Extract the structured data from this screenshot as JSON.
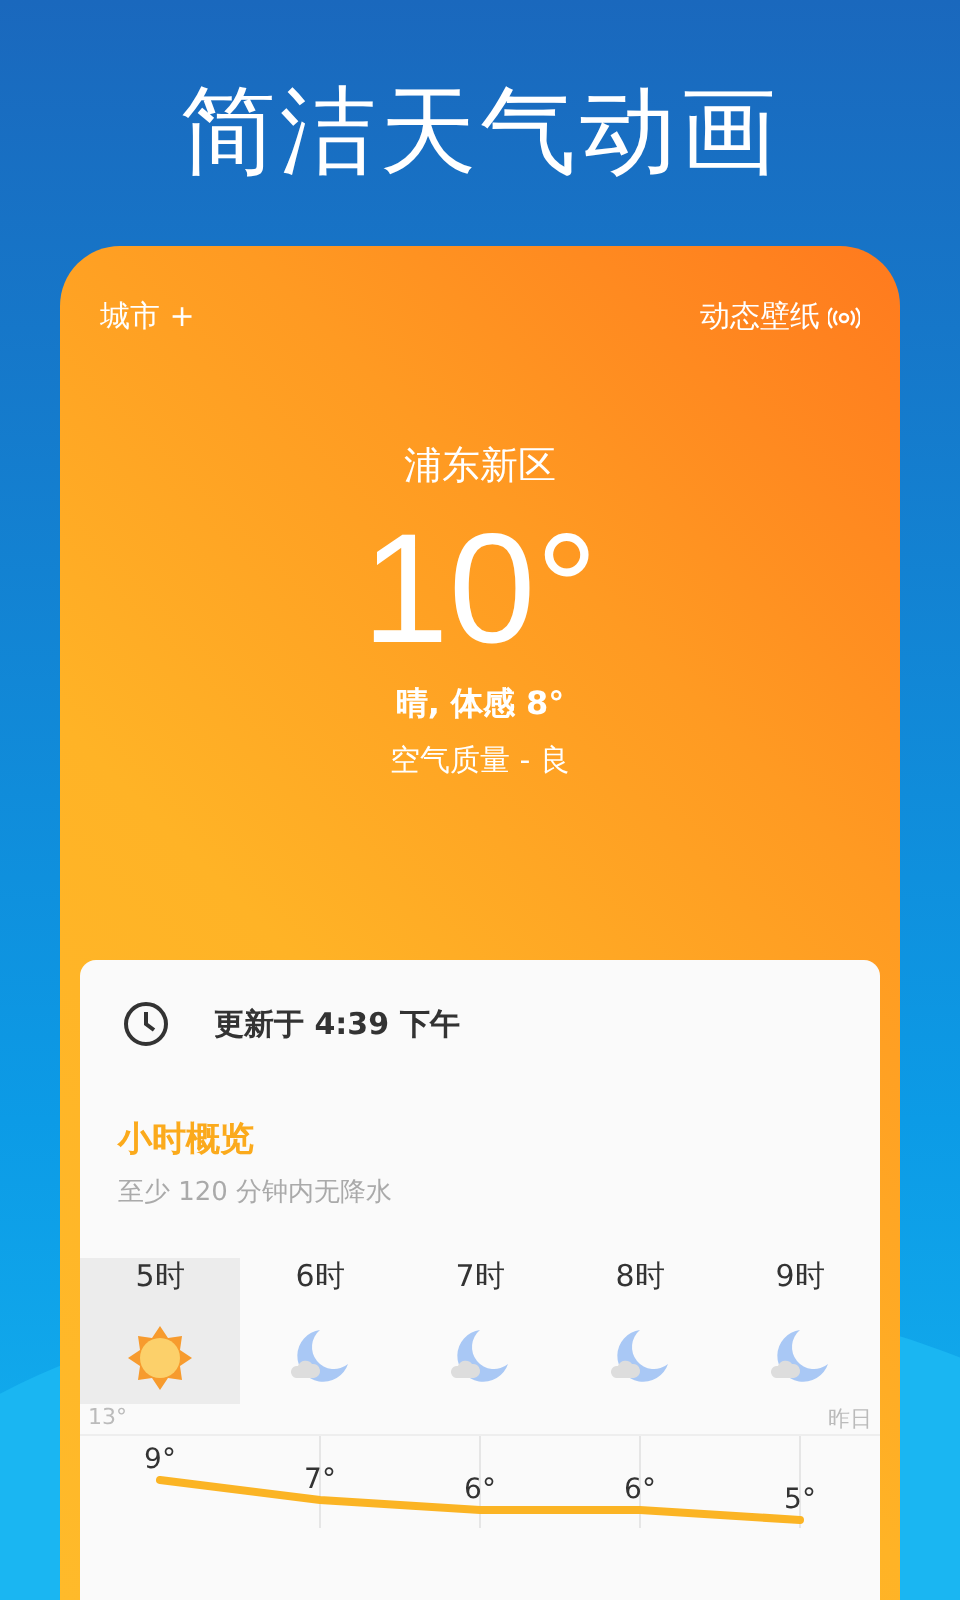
{
  "headline": "简洁天气动画",
  "top_bar": {
    "city_button": "城市 +",
    "wallpaper_button": "动态壁纸"
  },
  "current": {
    "location": "浦东新区",
    "temperature": "10°",
    "condition": "晴, 体感 8°",
    "air_quality": "空气质量 - 良"
  },
  "updated": "更新于 4:39 下午",
  "hourly": {
    "title": "小时概览",
    "subtitle": "至少 120 分钟内无降水",
    "hours": [
      {
        "time": "5时",
        "kind": "sun",
        "selected": true
      },
      {
        "time": "6时",
        "kind": "moon-cloud",
        "selected": false
      },
      {
        "time": "7时",
        "kind": "moon-cloud",
        "selected": false
      },
      {
        "time": "8时",
        "kind": "moon-cloud",
        "selected": false
      },
      {
        "time": "9时",
        "kind": "moon-cloud",
        "selected": false
      }
    ],
    "high_label": "13°",
    "yesterday_label": "昨日",
    "chart_data": {
      "type": "line",
      "grid": true,
      "series": [
        {
          "color": "#fbb424",
          "values": [
            9,
            7,
            6,
            6,
            5
          ],
          "value_labels": [
            "9°",
            "7°",
            "6°",
            "6°",
            "5°"
          ]
        }
      ]
    }
  }
}
